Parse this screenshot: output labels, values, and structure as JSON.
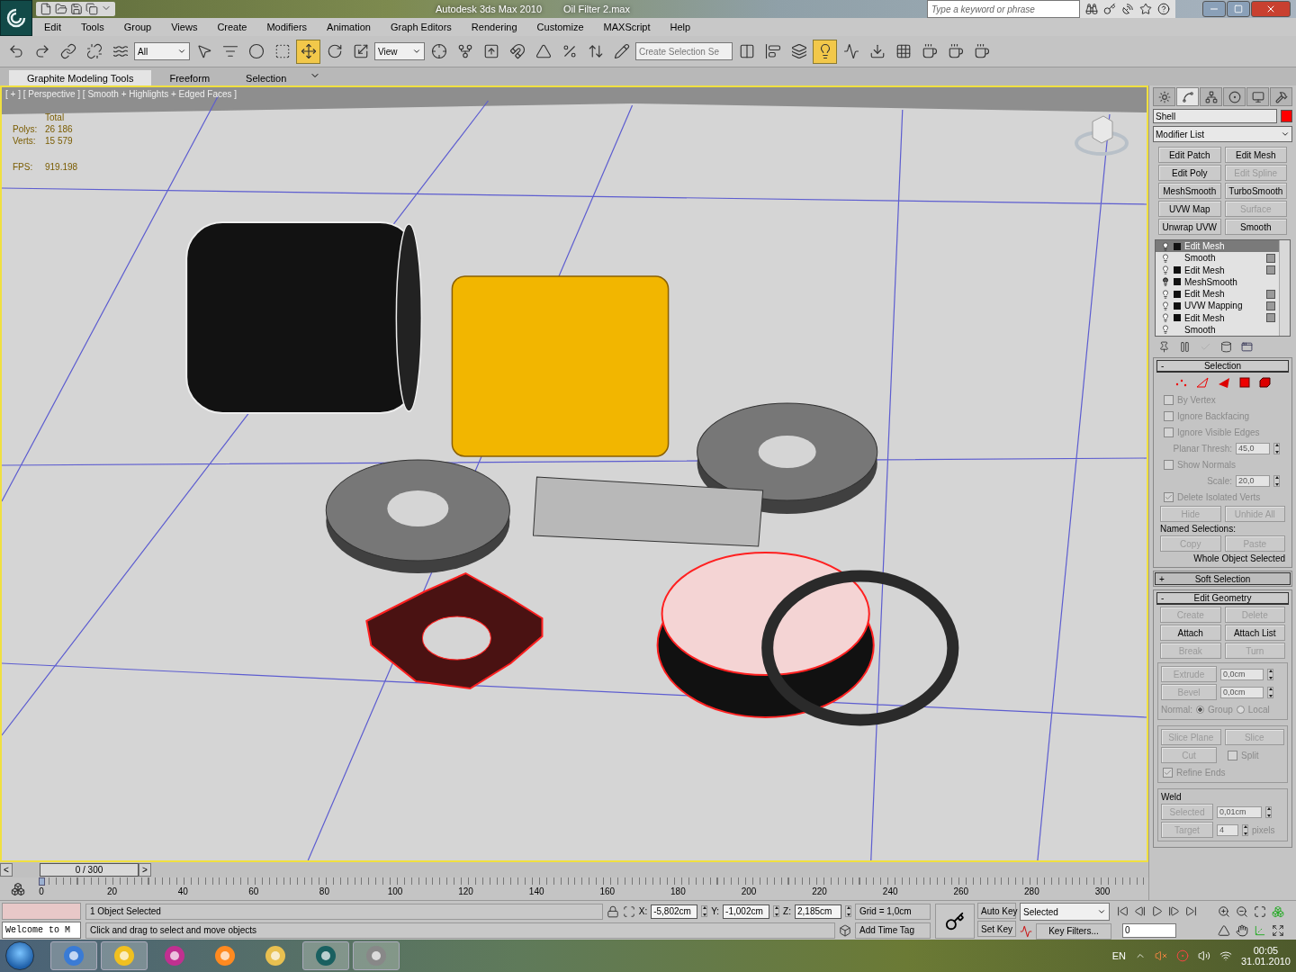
{
  "title_bar": {
    "app": "Autodesk 3ds Max  2010",
    "file": "Oil Filter 2.max",
    "search": {
      "placeholder": "Type a keyword or phrase"
    }
  },
  "menu": [
    "Edit",
    "Tools",
    "Group",
    "Views",
    "Create",
    "Modifiers",
    "Animation",
    "Graph Editors",
    "Rendering",
    "Customize",
    "MAXScript",
    "Help"
  ],
  "toolbar": [
    {
      "kind": "button",
      "active": false
    },
    {
      "kind": "button",
      "active": false
    },
    {
      "kind": "button",
      "active": false
    },
    {
      "kind": "button",
      "active": false
    },
    {
      "kind": "button",
      "active": false
    },
    {
      "kind": "dropdown",
      "value": "All"
    },
    {
      "kind": "button",
      "active": false
    },
    {
      "kind": "button",
      "active": false
    },
    {
      "kind": "button",
      "active": false
    },
    {
      "kind": "button",
      "active": false
    },
    {
      "kind": "button",
      "active": true
    },
    {
      "kind": "button",
      "active": false
    },
    {
      "kind": "button",
      "active": false
    },
    {
      "kind": "dropdown",
      "value": "View"
    },
    {
      "kind": "button",
      "active": false
    },
    {
      "kind": "button",
      "active": false
    },
    {
      "kind": "button",
      "active": false
    },
    {
      "kind": "button",
      "active": false
    },
    {
      "kind": "button",
      "active": false
    },
    {
      "kind": "button",
      "active": false
    },
    {
      "kind": "button",
      "active": false
    },
    {
      "kind": "button",
      "active": false
    },
    {
      "kind": "combo",
      "placeholder": "Create Selection Se"
    },
    {
      "kind": "button",
      "active": false
    },
    {
      "kind": "button",
      "active": false
    },
    {
      "kind": "button",
      "active": false
    },
    {
      "kind": "button",
      "active": true
    },
    {
      "kind": "button",
      "active": false
    },
    {
      "kind": "button",
      "active": false
    },
    {
      "kind": "button",
      "active": false
    },
    {
      "kind": "button",
      "active": false
    },
    {
      "kind": "button",
      "active": false
    },
    {
      "kind": "button",
      "active": false
    }
  ],
  "ribbon_tabs": [
    {
      "label": "Graphite Modeling Tools",
      "selected": true
    },
    {
      "label": "Freeform",
      "selected": false
    },
    {
      "label": "Selection",
      "selected": false
    }
  ],
  "viewport": {
    "label": "[ + ] [ Perspective ] [ Smooth + Highlights + Edged Faces ]",
    "stats_heading": "Total",
    "stats": [
      {
        "label": "Polys:",
        "value": "26 186"
      },
      {
        "label": "Verts:",
        "value": "15 579"
      }
    ],
    "fps": {
      "label": "FPS:",
      "value": "919.198"
    }
  },
  "command_panel": {
    "tabs": [
      {
        "selected": false
      },
      {
        "selected": true
      },
      {
        "selected": false
      },
      {
        "selected": false
      },
      {
        "selected": false
      },
      {
        "selected": false
      }
    ],
    "object_name": "Shell",
    "modifier_list": "Modifier List",
    "modifier_buttons": [
      {
        "label": "Edit Patch",
        "disabled": false
      },
      {
        "label": "Edit Mesh",
        "disabled": false
      },
      {
        "label": "Edit Poly",
        "disabled": false
      },
      {
        "label": "Edit Spline",
        "disabled": true
      },
      {
        "label": "MeshSmooth",
        "disabled": false
      },
      {
        "label": "TurboSmooth",
        "disabled": false
      },
      {
        "label": "UVW Map",
        "disabled": false
      },
      {
        "label": "Surface",
        "disabled": true
      },
      {
        "label": "Unwrap UVW",
        "disabled": false
      },
      {
        "label": "Smooth",
        "disabled": false
      }
    ],
    "stack": [
      {
        "label": "Edit Mesh",
        "selected": true,
        "on": true,
        "expandable": true,
        "box": false
      },
      {
        "label": "Smooth",
        "selected": false,
        "on": true,
        "expandable": false,
        "box": true
      },
      {
        "label": "Edit Mesh",
        "selected": false,
        "on": true,
        "expandable": true,
        "box": true
      },
      {
        "label": "MeshSmooth",
        "selected": false,
        "on": false,
        "expandable": true,
        "box": false
      },
      {
        "label": "Edit Mesh",
        "selected": false,
        "on": true,
        "expandable": true,
        "box": true
      },
      {
        "label": "UVW Mapping",
        "selected": false,
        "on": true,
        "expandable": true,
        "box": true
      },
      {
        "label": "Edit Mesh",
        "selected": false,
        "on": true,
        "expandable": true,
        "box": true
      },
      {
        "label": "Smooth",
        "selected": false,
        "on": true,
        "expandable": false,
        "box": false
      }
    ],
    "selection": {
      "toggle": "-",
      "title": "Selection",
      "expanded": true,
      "options": [
        {
          "kind": "check",
          "label": "By Vertex",
          "checked": false,
          "disabled": true
        },
        {
          "kind": "check",
          "label": "Ignore Backfacing",
          "checked": false,
          "disabled": true
        },
        {
          "kind": "check",
          "label": "Ignore Visible Edges",
          "checked": false,
          "disabled": true
        },
        {
          "kind": "spinner",
          "label": "Planar Thresh:",
          "value": "45,0",
          "disabled": true
        },
        {
          "kind": "check",
          "label": "Show Normals",
          "checked": false,
          "disabled": true
        },
        {
          "kind": "spinner",
          "label": "Scale:",
          "value": "20,0",
          "disabled": true
        },
        {
          "kind": "check",
          "label": "Delete Isolated Verts",
          "checked": true,
          "disabled": true
        }
      ],
      "buttons": [
        {
          "label": "Hide",
          "disabled": true
        },
        {
          "label": "Unhide All",
          "disabled": true
        }
      ],
      "named_label": "Named Selections:",
      "named_buttons": [
        {
          "label": "Copy",
          "disabled": true
        },
        {
          "label": "Paste",
          "disabled": true
        }
      ],
      "status": "Whole Object Selected"
    },
    "soft_selection": {
      "toggle": "+",
      "title": "Soft Selection",
      "expanded": false
    },
    "edit_geometry": {
      "toggle": "-",
      "title": "Edit Geometry",
      "expanded": true,
      "buttons": [
        {
          "label": "Create",
          "disabled": true
        },
        {
          "label": "Delete",
          "disabled": true
        },
        {
          "label": "Attach",
          "disabled": false
        },
        {
          "label": "Attach List",
          "disabled": false
        },
        {
          "label": "Break",
          "disabled": true
        },
        {
          "label": "Turn",
          "disabled": true
        }
      ],
      "extrude": [
        {
          "button": "Extrude",
          "value": "0,0cm"
        },
        {
          "button": "Bevel",
          "value": "0,0cm"
        }
      ],
      "normal_label": "Normal:",
      "normal": [
        {
          "label": "Group",
          "selected": true
        },
        {
          "label": "Local",
          "selected": false
        }
      ],
      "slice_buttons": [
        {
          "label": "Slice Plane",
          "disabled": true
        },
        {
          "label": "Slice",
          "disabled": true
        }
      ],
      "cut": {
        "label": "Cut",
        "disabled": true
      },
      "split": {
        "label": "Split",
        "checked": false
      },
      "refine": {
        "label": "Refine Ends",
        "checked": true
      },
      "weld_title": "Weld",
      "weld": [
        {
          "button": "Selected",
          "value": "0,01cm"
        },
        {
          "button": "Target",
          "value": "4",
          "unit": "pixels"
        }
      ]
    }
  },
  "time_slider": {
    "prev": "<",
    "label": "0 / 300",
    "next": ">"
  },
  "track_labels": [
    "0",
    "20",
    "40",
    "60",
    "80",
    "100",
    "120",
    "140",
    "160",
    "180",
    "200",
    "220",
    "240",
    "260",
    "280",
    "300"
  ],
  "status": {
    "listener": "Welcome to M",
    "selection": "1 Object Selected",
    "prompt": "Click and drag to select and move objects",
    "coords": [
      {
        "label": "X:",
        "value": "-5,802cm"
      },
      {
        "label": "Y:",
        "value": "-1,002cm"
      },
      {
        "label": "Z:",
        "value": "2,185cm"
      }
    ],
    "grid": "Grid = 1,0cm",
    "time_tag": "Add Time Tag",
    "auto_key": "Auto Key",
    "set_key": "Set Key",
    "key_mode": "Selected",
    "key_filters": "Key Filters...",
    "frame": "0"
  },
  "taskbar": {
    "apps": [
      {
        "running": true
      },
      {
        "running": true
      },
      {
        "running": false
      },
      {
        "running": false
      },
      {
        "running": false
      },
      {
        "running": true
      },
      {
        "running": true
      }
    ],
    "language": "EN",
    "time": "00:05",
    "date": "31.01.2010"
  }
}
